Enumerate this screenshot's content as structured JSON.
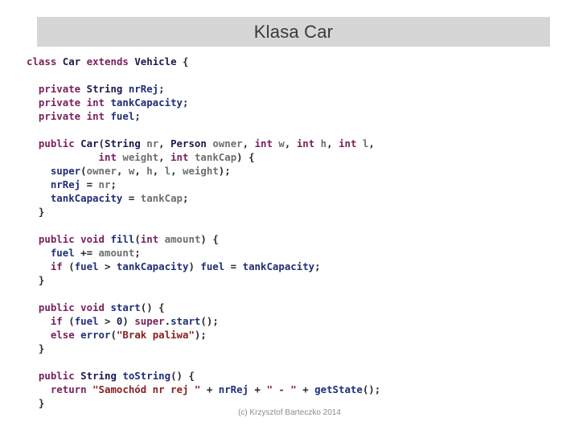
{
  "slide": {
    "title": "Klasa Car",
    "background_color": "#ffffff",
    "title_bar_color": "#d6d6d6"
  },
  "footer": {
    "credit": "(c) Krzysztof Barteczko 2014"
  },
  "colors": {
    "keyword": "#7b1f5c",
    "type": "#1a1a4e",
    "identifier": "#1f2f7a",
    "variable": "#6e6e6e",
    "string": "#8a2020",
    "punctuation": "#2a2a2a"
  },
  "code": {
    "language": "Java",
    "plain_text": "class Car extends Vehicle {\n\n  private String nrRej;\n  private int tankCapacity;\n  private int fuel;\n\n  public Car(String nr, Person owner, int w, int h, int l,\n            int weight, int tankCap) {\n    super(owner, w, h, l, weight);\n    nrRej = nr;\n    tankCapacity = tankCap;\n  }\n\n  public void fill(int amount) {\n    fuel += amount;\n    if (fuel > tankCapacity) fuel = tankCapacity;\n  }\n\n  public void start() {\n    if (fuel > 0) super.start();\n    else error(\"Brak paliwa\");\n  }\n\n  public String toString() {\n    return \"Samochód nr rej \" + nrRej + \" - \" + getState();\n  }",
    "lines": [
      {
        "tokens": [
          {
            "t": "class",
            "c": "kw"
          },
          {
            "t": " ",
            "c": "punc"
          },
          {
            "t": "Car",
            "c": "type"
          },
          {
            "t": " ",
            "c": "punc"
          },
          {
            "t": "extends",
            "c": "kw"
          },
          {
            "t": " ",
            "c": "punc"
          },
          {
            "t": "Vehicle",
            "c": "type"
          },
          {
            "t": " {",
            "c": "punc"
          }
        ]
      },
      {
        "tokens": []
      },
      {
        "tokens": [
          {
            "t": "  ",
            "c": "punc"
          },
          {
            "t": "private",
            "c": "kw"
          },
          {
            "t": " ",
            "c": "punc"
          },
          {
            "t": "String",
            "c": "type"
          },
          {
            "t": " ",
            "c": "punc"
          },
          {
            "t": "nrRej",
            "c": "id"
          },
          {
            "t": ";",
            "c": "punc"
          }
        ]
      },
      {
        "tokens": [
          {
            "t": "  ",
            "c": "punc"
          },
          {
            "t": "private",
            "c": "kw"
          },
          {
            "t": " ",
            "c": "punc"
          },
          {
            "t": "int",
            "c": "kw"
          },
          {
            "t": " ",
            "c": "punc"
          },
          {
            "t": "tankCapacity",
            "c": "id"
          },
          {
            "t": ";",
            "c": "punc"
          }
        ]
      },
      {
        "tokens": [
          {
            "t": "  ",
            "c": "punc"
          },
          {
            "t": "private",
            "c": "kw"
          },
          {
            "t": " ",
            "c": "punc"
          },
          {
            "t": "int",
            "c": "kw"
          },
          {
            "t": " ",
            "c": "punc"
          },
          {
            "t": "fuel",
            "c": "id"
          },
          {
            "t": ";",
            "c": "punc"
          }
        ]
      },
      {
        "tokens": []
      },
      {
        "tokens": [
          {
            "t": "  ",
            "c": "punc"
          },
          {
            "t": "public",
            "c": "kw"
          },
          {
            "t": " ",
            "c": "punc"
          },
          {
            "t": "Car",
            "c": "type"
          },
          {
            "t": "(",
            "c": "punc"
          },
          {
            "t": "String",
            "c": "type"
          },
          {
            "t": " ",
            "c": "punc"
          },
          {
            "t": "nr",
            "c": "var"
          },
          {
            "t": ", ",
            "c": "punc"
          },
          {
            "t": "Person",
            "c": "type"
          },
          {
            "t": " ",
            "c": "punc"
          },
          {
            "t": "owner",
            "c": "var"
          },
          {
            "t": ", ",
            "c": "punc"
          },
          {
            "t": "int",
            "c": "kw"
          },
          {
            "t": " ",
            "c": "punc"
          },
          {
            "t": "w",
            "c": "var"
          },
          {
            "t": ", ",
            "c": "punc"
          },
          {
            "t": "int",
            "c": "kw"
          },
          {
            "t": " ",
            "c": "punc"
          },
          {
            "t": "h",
            "c": "var"
          },
          {
            "t": ", ",
            "c": "punc"
          },
          {
            "t": "int",
            "c": "kw"
          },
          {
            "t": " ",
            "c": "punc"
          },
          {
            "t": "l",
            "c": "var"
          },
          {
            "t": ",",
            "c": "punc"
          }
        ]
      },
      {
        "tokens": [
          {
            "t": "            ",
            "c": "punc"
          },
          {
            "t": "int",
            "c": "kw"
          },
          {
            "t": " ",
            "c": "punc"
          },
          {
            "t": "weight",
            "c": "var"
          },
          {
            "t": ", ",
            "c": "punc"
          },
          {
            "t": "int",
            "c": "kw"
          },
          {
            "t": " ",
            "c": "punc"
          },
          {
            "t": "tankCap",
            "c": "var"
          },
          {
            "t": ") {",
            "c": "punc"
          }
        ]
      },
      {
        "tokens": [
          {
            "t": "    ",
            "c": "punc"
          },
          {
            "t": "super",
            "c": "id"
          },
          {
            "t": "(",
            "c": "punc"
          },
          {
            "t": "owner",
            "c": "var"
          },
          {
            "t": ", ",
            "c": "punc"
          },
          {
            "t": "w",
            "c": "var"
          },
          {
            "t": ", ",
            "c": "punc"
          },
          {
            "t": "h",
            "c": "var"
          },
          {
            "t": ", ",
            "c": "punc"
          },
          {
            "t": "l",
            "c": "var"
          },
          {
            "t": ", ",
            "c": "punc"
          },
          {
            "t": "weight",
            "c": "var"
          },
          {
            "t": ");",
            "c": "punc"
          }
        ]
      },
      {
        "tokens": [
          {
            "t": "    ",
            "c": "punc"
          },
          {
            "t": "nrRej",
            "c": "id"
          },
          {
            "t": " = ",
            "c": "punc"
          },
          {
            "t": "nr",
            "c": "var"
          },
          {
            "t": ";",
            "c": "punc"
          }
        ]
      },
      {
        "tokens": [
          {
            "t": "    ",
            "c": "punc"
          },
          {
            "t": "tankCapacity",
            "c": "id"
          },
          {
            "t": " = ",
            "c": "punc"
          },
          {
            "t": "tankCap",
            "c": "var"
          },
          {
            "t": ";",
            "c": "punc"
          }
        ]
      },
      {
        "tokens": [
          {
            "t": "  }",
            "c": "punc"
          }
        ]
      },
      {
        "tokens": []
      },
      {
        "tokens": [
          {
            "t": "  ",
            "c": "punc"
          },
          {
            "t": "public",
            "c": "kw"
          },
          {
            "t": " ",
            "c": "punc"
          },
          {
            "t": "void",
            "c": "kw"
          },
          {
            "t": " ",
            "c": "punc"
          },
          {
            "t": "fill",
            "c": "id"
          },
          {
            "t": "(",
            "c": "punc"
          },
          {
            "t": "int",
            "c": "kw"
          },
          {
            "t": " ",
            "c": "punc"
          },
          {
            "t": "amount",
            "c": "var"
          },
          {
            "t": ") {",
            "c": "punc"
          }
        ]
      },
      {
        "tokens": [
          {
            "t": "    ",
            "c": "punc"
          },
          {
            "t": "fuel",
            "c": "id"
          },
          {
            "t": " += ",
            "c": "punc"
          },
          {
            "t": "amount",
            "c": "var"
          },
          {
            "t": ";",
            "c": "punc"
          }
        ]
      },
      {
        "tokens": [
          {
            "t": "    ",
            "c": "punc"
          },
          {
            "t": "if",
            "c": "kw"
          },
          {
            "t": " (",
            "c": "punc"
          },
          {
            "t": "fuel",
            "c": "id"
          },
          {
            "t": " > ",
            "c": "punc"
          },
          {
            "t": "tankCapacity",
            "c": "id"
          },
          {
            "t": ") ",
            "c": "punc"
          },
          {
            "t": "fuel",
            "c": "id"
          },
          {
            "t": " = ",
            "c": "punc"
          },
          {
            "t": "tankCapacity",
            "c": "id"
          },
          {
            "t": ";",
            "c": "punc"
          }
        ]
      },
      {
        "tokens": [
          {
            "t": "  }",
            "c": "punc"
          }
        ]
      },
      {
        "tokens": []
      },
      {
        "tokens": [
          {
            "t": "  ",
            "c": "punc"
          },
          {
            "t": "public",
            "c": "kw"
          },
          {
            "t": " ",
            "c": "punc"
          },
          {
            "t": "void",
            "c": "kw"
          },
          {
            "t": " ",
            "c": "punc"
          },
          {
            "t": "start",
            "c": "id"
          },
          {
            "t": "() {",
            "c": "punc"
          }
        ]
      },
      {
        "tokens": [
          {
            "t": "    ",
            "c": "punc"
          },
          {
            "t": "if",
            "c": "kw"
          },
          {
            "t": " (",
            "c": "punc"
          },
          {
            "t": "fuel",
            "c": "id"
          },
          {
            "t": " > ",
            "c": "punc"
          },
          {
            "t": "0",
            "c": "num"
          },
          {
            "t": ") ",
            "c": "punc"
          },
          {
            "t": "super",
            "c": "kw"
          },
          {
            "t": ".",
            "c": "punc"
          },
          {
            "t": "start",
            "c": "id"
          },
          {
            "t": "();",
            "c": "punc"
          }
        ]
      },
      {
        "tokens": [
          {
            "t": "    ",
            "c": "punc"
          },
          {
            "t": "else",
            "c": "kw"
          },
          {
            "t": " ",
            "c": "punc"
          },
          {
            "t": "error",
            "c": "id"
          },
          {
            "t": "(",
            "c": "punc"
          },
          {
            "t": "\"Brak paliwa\"",
            "c": "str"
          },
          {
            "t": ");",
            "c": "punc"
          }
        ]
      },
      {
        "tokens": [
          {
            "t": "  }",
            "c": "punc"
          }
        ]
      },
      {
        "tokens": []
      },
      {
        "tokens": [
          {
            "t": "  ",
            "c": "punc"
          },
          {
            "t": "public",
            "c": "kw"
          },
          {
            "t": " ",
            "c": "punc"
          },
          {
            "t": "String",
            "c": "type"
          },
          {
            "t": " ",
            "c": "punc"
          },
          {
            "t": "toString",
            "c": "id"
          },
          {
            "t": "() {",
            "c": "punc"
          }
        ]
      },
      {
        "tokens": [
          {
            "t": "    ",
            "c": "punc"
          },
          {
            "t": "return",
            "c": "kw"
          },
          {
            "t": " ",
            "c": "punc"
          },
          {
            "t": "\"Samochód nr rej \"",
            "c": "str"
          },
          {
            "t": " + ",
            "c": "punc"
          },
          {
            "t": "nrRej",
            "c": "id"
          },
          {
            "t": " + ",
            "c": "punc"
          },
          {
            "t": "\" - \"",
            "c": "str"
          },
          {
            "t": " + ",
            "c": "punc"
          },
          {
            "t": "getState",
            "c": "id"
          },
          {
            "t": "();",
            "c": "punc"
          }
        ]
      },
      {
        "tokens": [
          {
            "t": "  }",
            "c": "punc"
          }
        ]
      }
    ]
  }
}
